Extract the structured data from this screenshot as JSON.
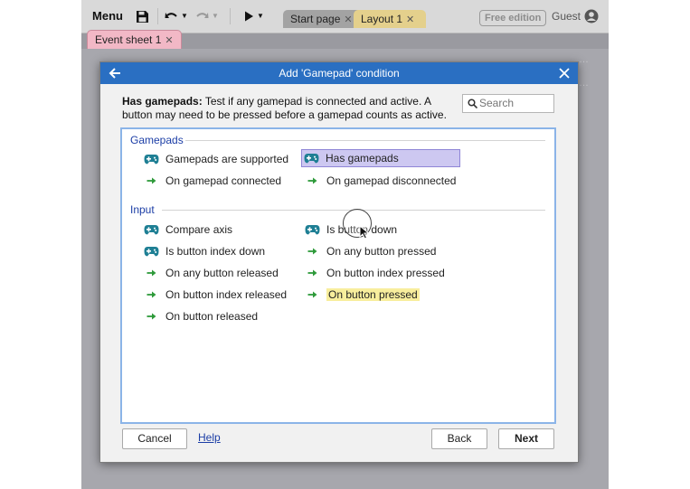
{
  "toolbar": {
    "menu_label": "Menu",
    "tabs": [
      {
        "label": "Start page"
      },
      {
        "label": "Layout 1"
      }
    ],
    "edition_badge": "Free edition",
    "user_label": "Guest"
  },
  "event_sheet_tab": "Event sheet 1",
  "dialog": {
    "title": "Add 'Gamepad' condition",
    "description_bold": "Has gamepads:",
    "description_text": " Test if any gamepad is connected and active. A button may need to be pressed before a gamepad counts as active.",
    "search_placeholder": "Search",
    "groups": [
      {
        "title": "Gamepads",
        "items": [
          {
            "label": "Gamepads are supported",
            "icon": "gamepad-icon"
          },
          {
            "label": "Has gamepads",
            "icon": "gamepad-icon",
            "selected": true
          },
          {
            "label": "On gamepad connected",
            "icon": "trigger-arrow-icon"
          },
          {
            "label": "On gamepad disconnected",
            "icon": "trigger-arrow-icon"
          }
        ]
      },
      {
        "title": "Input",
        "items": [
          {
            "label": "Compare axis",
            "icon": "gamepad-icon"
          },
          {
            "label": "Is button down",
            "icon": "gamepad-icon"
          },
          {
            "label": "Is button index down",
            "icon": "gamepad-icon"
          },
          {
            "label": "On any button pressed",
            "icon": "trigger-arrow-icon"
          },
          {
            "label": "On any button released",
            "icon": "trigger-arrow-icon"
          },
          {
            "label": "On button index pressed",
            "icon": "trigger-arrow-icon"
          },
          {
            "label": "On button index released",
            "icon": "trigger-arrow-icon"
          },
          {
            "label": "On button pressed",
            "icon": "trigger-arrow-icon",
            "highlighted": true
          },
          {
            "label": "On button released",
            "icon": "trigger-arrow-icon"
          }
        ]
      }
    ],
    "buttons": {
      "cancel": "Cancel",
      "help": "Help",
      "back": "Back",
      "next": "Next"
    }
  },
  "colors": {
    "titlebar": "#2a6fc2",
    "group_title": "#1c3ea6",
    "gamepad_icon": "#1e7f94",
    "trigger_arrow": "#2e9a3a",
    "selection": "#cdc8f1",
    "highlight": "#f8ee9d"
  }
}
